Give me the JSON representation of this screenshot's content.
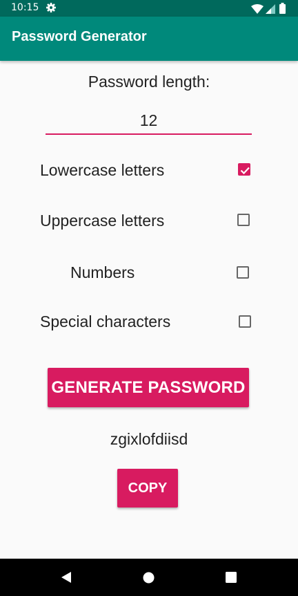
{
  "status_bar": {
    "time": "10:15",
    "icons": [
      "settings-icon",
      "wifi-icon",
      "signal-icon",
      "battery-icon"
    ]
  },
  "app_bar": {
    "title": "Password Generator"
  },
  "form": {
    "length_label": "Password length:",
    "length_value": "12",
    "options": [
      {
        "label": "Lowercase letters",
        "checked": true
      },
      {
        "label": "Uppercase letters",
        "checked": false
      },
      {
        "label": "Numbers",
        "checked": false
      },
      {
        "label": "Special characters",
        "checked": false
      }
    ],
    "generate_label": "GENERATE PASSWORD",
    "password": "zgixlofdiisd",
    "copy_label": "COPY"
  },
  "nav_bar": {
    "icons": [
      "back-icon",
      "home-icon",
      "recents-icon"
    ]
  },
  "colors": {
    "status_bar": "#00695c",
    "app_bar": "#00897b",
    "accent": "#d81b60",
    "background": "#fafafa"
  }
}
